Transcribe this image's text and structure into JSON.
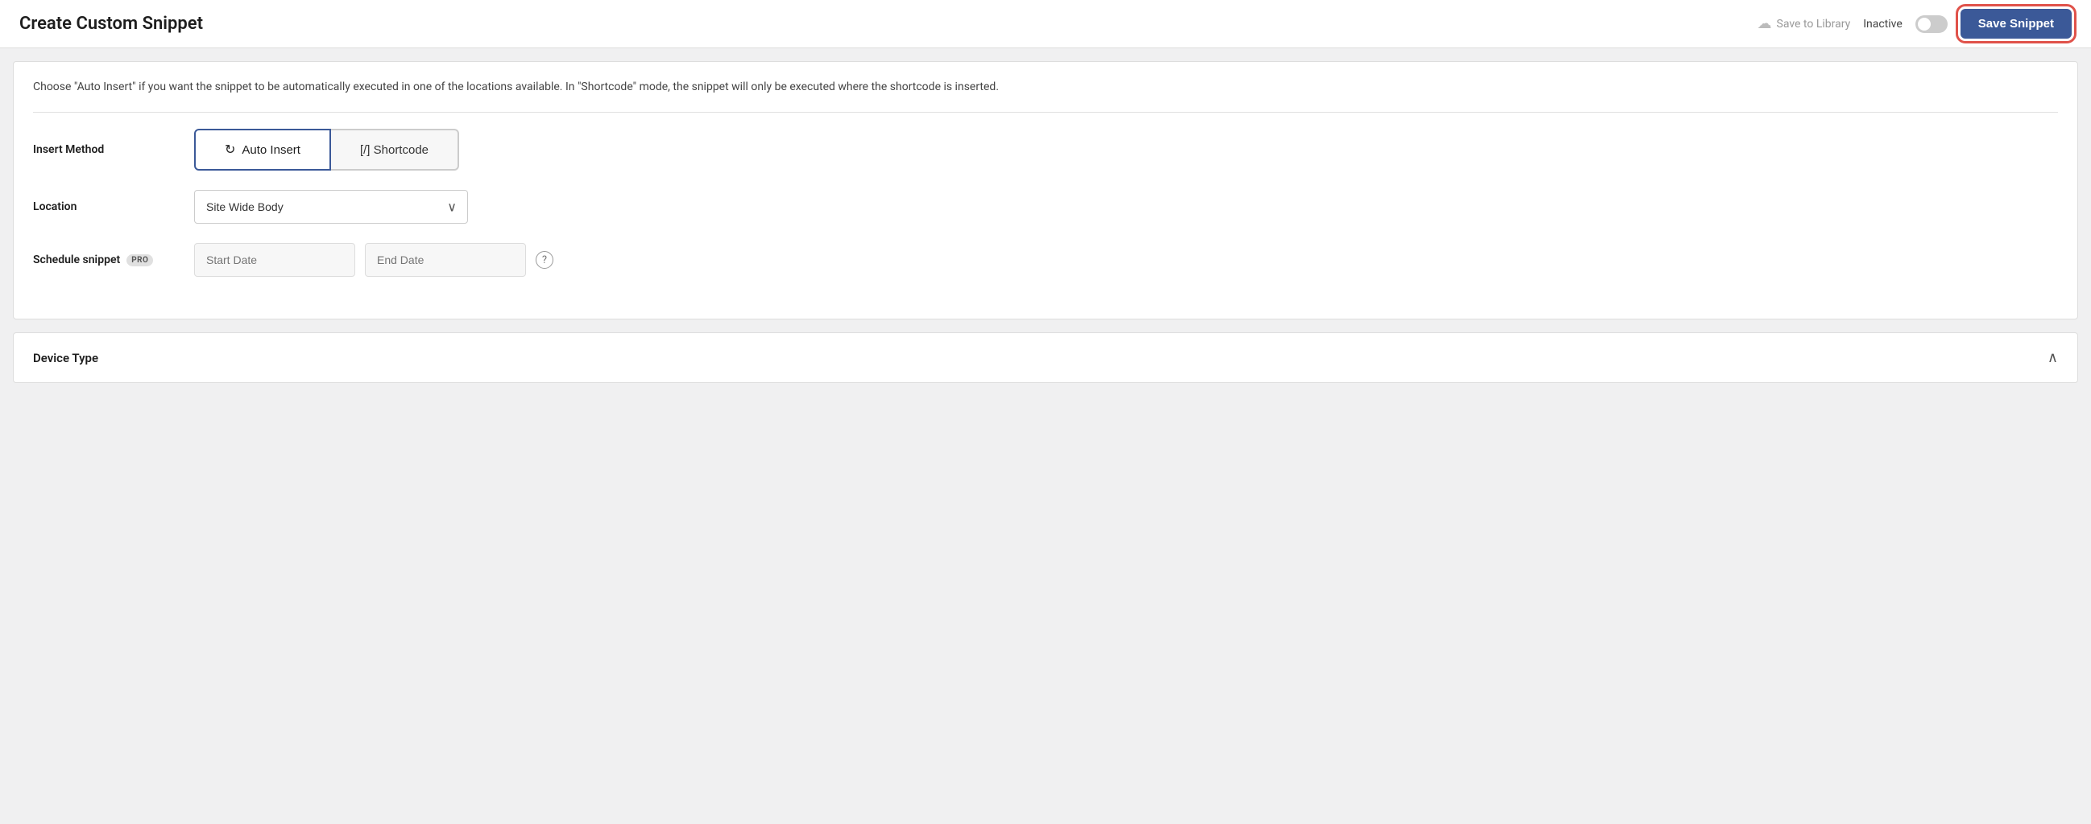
{
  "header": {
    "title": "Create Custom Snippet",
    "save_to_library_label": "Save to Library",
    "inactive_label": "Inactive",
    "save_snippet_label": "Save Snippet",
    "toggle_state": false
  },
  "description": {
    "text": "Choose \"Auto Insert\" if you want the snippet to be automatically executed in one of the locations available. In \"Shortcode\" mode, the snippet will only be executed where the shortcode is inserted."
  },
  "form": {
    "insert_method_label": "Insert Method",
    "auto_insert_label": "Auto Insert",
    "shortcode_label": "[/] Shortcode",
    "location_label": "Location",
    "location_value": "Site Wide Body",
    "schedule_snippet_label": "Schedule snippet",
    "pro_badge_label": "PRO",
    "start_date_placeholder": "Start Date",
    "end_date_placeholder": "End Date"
  },
  "device_type": {
    "title": "Device Type"
  },
  "icons": {
    "cloud": "☁",
    "auto_insert": "↻",
    "chevron_down": "∨",
    "chevron_up": "∧",
    "help": "?"
  }
}
